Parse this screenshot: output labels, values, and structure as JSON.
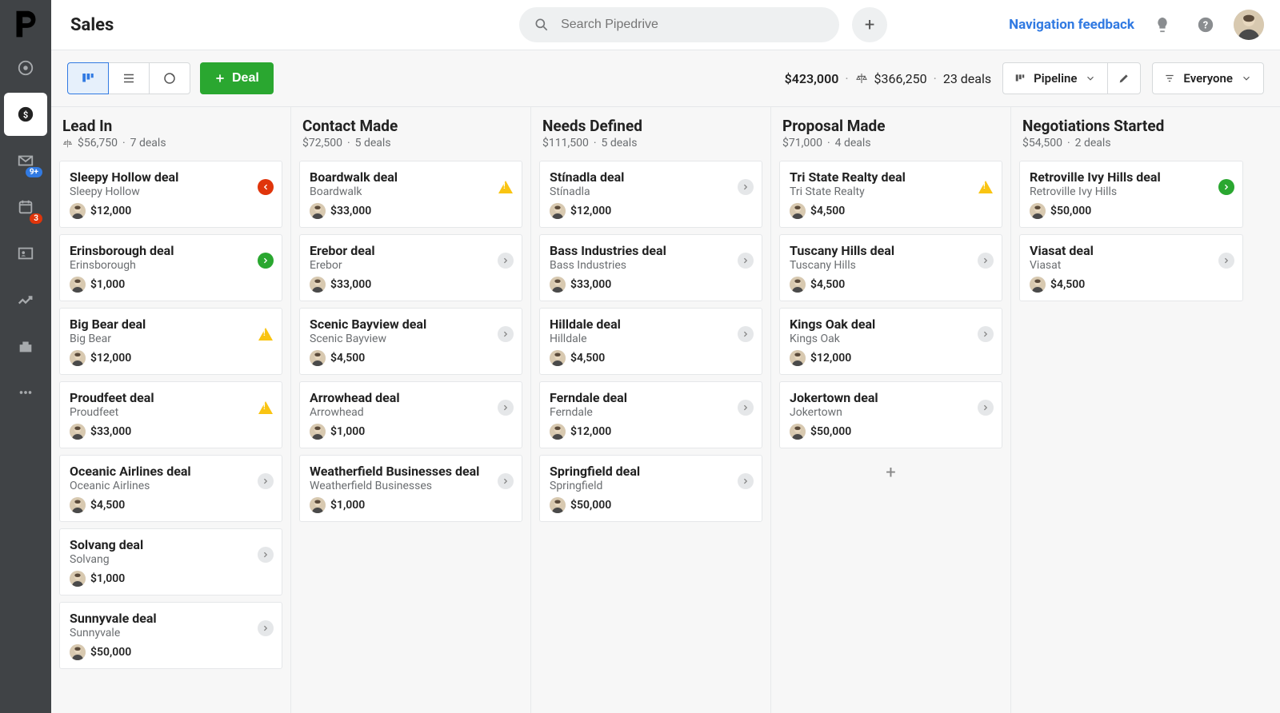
{
  "header": {
    "title": "Sales",
    "search_placeholder": "Search Pipedrive",
    "nav_feedback": "Navigation feedback"
  },
  "sidebar": {
    "mail_badge": "9+",
    "calendar_badge": "3"
  },
  "toolbar": {
    "deal_label": "Deal",
    "pipeline_label": "Pipeline",
    "everyone_label": "Everyone",
    "summary_total": "$423,000",
    "summary_weighted": "$366,250",
    "summary_count": "23 deals"
  },
  "columns": [
    {
      "name": "Lead In",
      "amount": "$56,750",
      "count": "7 deals",
      "show_scale": true,
      "cards": [
        {
          "title": "Sleepy Hollow deal",
          "org": "Sleepy Hollow",
          "value": "$12,000",
          "status": "red"
        },
        {
          "title": "Erinsborough deal",
          "org": "Erinsborough",
          "value": "$1,000",
          "status": "green"
        },
        {
          "title": "Big Bear deal",
          "org": "Big Bear",
          "value": "$12,000",
          "status": "warn"
        },
        {
          "title": "Proudfeet deal",
          "org": "Proudfeet",
          "value": "$33,000",
          "status": "warn"
        },
        {
          "title": "Oceanic Airlines deal",
          "org": "Oceanic Airlines",
          "value": "$4,500",
          "status": "gray"
        },
        {
          "title": "Solvang deal",
          "org": "Solvang",
          "value": "$1,000",
          "status": "gray"
        },
        {
          "title": "Sunnyvale deal",
          "org": "Sunnyvale",
          "value": "$50,000",
          "status": "gray"
        }
      ]
    },
    {
      "name": "Contact Made",
      "amount": "$72,500",
      "count": "5 deals",
      "show_scale": false,
      "cards": [
        {
          "title": "Boardwalk deal",
          "org": "Boardwalk",
          "value": "$33,000",
          "status": "warn"
        },
        {
          "title": "Erebor deal",
          "org": "Erebor",
          "value": "$33,000",
          "status": "gray"
        },
        {
          "title": "Scenic Bayview deal",
          "org": "Scenic Bayview",
          "value": "$4,500",
          "status": "gray"
        },
        {
          "title": "Arrowhead deal",
          "org": "Arrowhead",
          "value": "$1,000",
          "status": "gray"
        },
        {
          "title": "Weatherfield Businesses deal",
          "org": "Weatherfield Businesses",
          "value": "$1,000",
          "status": "gray"
        }
      ]
    },
    {
      "name": "Needs Defined",
      "amount": "$111,500",
      "count": "5 deals",
      "show_scale": false,
      "cards": [
        {
          "title": "Stínadla deal",
          "org": "Stínadla",
          "value": "$12,000",
          "status": "gray"
        },
        {
          "title": "Bass Industries deal",
          "org": "Bass Industries",
          "value": "$33,000",
          "status": "gray"
        },
        {
          "title": "Hilldale deal",
          "org": "Hilldale",
          "value": "$4,500",
          "status": "gray"
        },
        {
          "title": "Ferndale deal",
          "org": "Ferndale",
          "value": "$12,000",
          "status": "gray"
        },
        {
          "title": "Springfield deal",
          "org": "Springfield",
          "value": "$50,000",
          "status": "gray"
        }
      ]
    },
    {
      "name": "Proposal Made",
      "amount": "$71,000",
      "count": "4 deals",
      "show_scale": false,
      "show_add": true,
      "cards": [
        {
          "title": "Tri State Realty deal",
          "org": "Tri State Realty",
          "value": "$4,500",
          "status": "warn"
        },
        {
          "title": "Tuscany Hills deal",
          "org": "Tuscany Hills",
          "value": "$4,500",
          "status": "gray"
        },
        {
          "title": "Kings Oak deal",
          "org": "Kings Oak",
          "value": "$12,000",
          "status": "gray"
        },
        {
          "title": "Jokertown deal",
          "org": "Jokertown",
          "value": "$50,000",
          "status": "gray"
        }
      ]
    },
    {
      "name": "Negotiations Started",
      "amount": "$54,500",
      "count": "2 deals",
      "show_scale": false,
      "cards": [
        {
          "title": "Retroville Ivy Hills deal",
          "org": "Retroville Ivy Hills",
          "value": "$50,000",
          "status": "green"
        },
        {
          "title": "Viasat deal",
          "org": "Viasat",
          "value": "$4,500",
          "status": "gray"
        }
      ]
    }
  ]
}
